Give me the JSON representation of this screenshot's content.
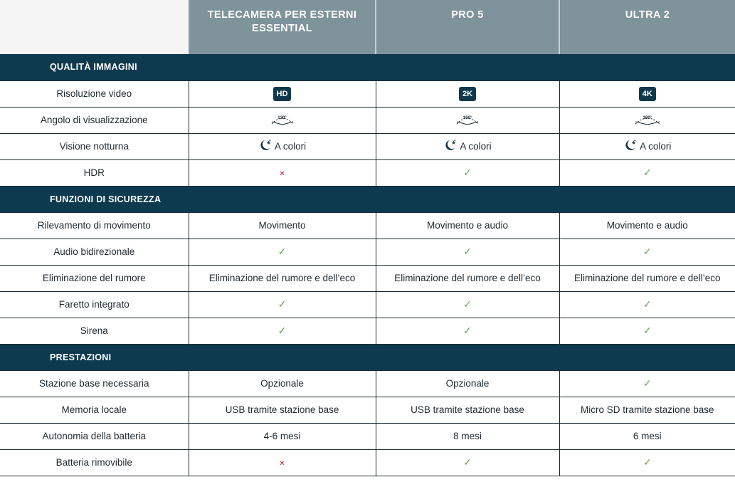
{
  "header": {
    "columns": [
      "TELECAMERA PER ESTERNI ESSENTIAL",
      "PRO 5",
      "ULTRA 2"
    ]
  },
  "sections": [
    {
      "title": "QUALITÀ IMMAGINI",
      "rows": [
        {
          "label": "Risoluzione video",
          "cells": [
            {
              "type": "badge",
              "text": "HD"
            },
            {
              "type": "badge",
              "text": "2K"
            },
            {
              "type": "badge",
              "text": "4K"
            }
          ]
        },
        {
          "label": "Angolo di visualizzazione",
          "cells": [
            {
              "type": "angle",
              "text": "130°",
              "icon": "viewing-angle-icon"
            },
            {
              "type": "angle",
              "text": "160°",
              "icon": "viewing-angle-icon"
            },
            {
              "type": "angle",
              "text": "180°",
              "icon": "viewing-angle-icon"
            }
          ]
        },
        {
          "label": "Visione notturna",
          "cells": [
            {
              "type": "night",
              "text": "A colori",
              "icon": "moon-stars-icon"
            },
            {
              "type": "night",
              "text": "A colori",
              "icon": "moon-stars-icon"
            },
            {
              "type": "night",
              "text": "A colori",
              "icon": "moon-stars-icon"
            }
          ]
        },
        {
          "label": "HDR",
          "cells": [
            {
              "type": "no",
              "text": "×"
            },
            {
              "type": "yes",
              "text": "✓"
            },
            {
              "type": "yes",
              "text": "✓"
            }
          ]
        }
      ]
    },
    {
      "title": "FUNZIONI DI SICUREZZA",
      "rows": [
        {
          "label": "Rilevamento di movimento",
          "cells": [
            {
              "type": "text",
              "text": "Movimento"
            },
            {
              "type": "text",
              "text": "Movimento e audio"
            },
            {
              "type": "text",
              "text": "Movimento e audio"
            }
          ]
        },
        {
          "label": "Audio bidirezionale",
          "cells": [
            {
              "type": "yes",
              "text": "✓"
            },
            {
              "type": "yes",
              "text": "✓"
            },
            {
              "type": "yes",
              "text": "✓"
            }
          ]
        },
        {
          "label": "Eliminazione del rumore",
          "cells": [
            {
              "type": "text",
              "text": "Eliminazione del rumore e dell’eco"
            },
            {
              "type": "text",
              "text": "Eliminazione del rumore e dell’eco"
            },
            {
              "type": "text",
              "text": "Eliminazione del rumore e dell’eco"
            }
          ]
        },
        {
          "label": "Faretto integrato",
          "cells": [
            {
              "type": "yes",
              "text": "✓"
            },
            {
              "type": "yes",
              "text": "✓"
            },
            {
              "type": "yes",
              "text": "✓"
            }
          ]
        },
        {
          "label": "Sirena",
          "cells": [
            {
              "type": "yes",
              "text": "✓"
            },
            {
              "type": "yes",
              "text": "✓"
            },
            {
              "type": "yes",
              "text": "✓"
            }
          ]
        }
      ]
    },
    {
      "title": "PRESTAZIONI",
      "rows": [
        {
          "label": "Stazione base necessaria",
          "cells": [
            {
              "type": "text",
              "text": "Opzionale"
            },
            {
              "type": "text",
              "text": "Opzionale"
            },
            {
              "type": "yes",
              "text": "✓"
            }
          ]
        },
        {
          "label": "Memoria locale",
          "cells": [
            {
              "type": "text",
              "text": "USB tramite stazione base"
            },
            {
              "type": "text",
              "text": "USB tramite stazione base"
            },
            {
              "type": "text",
              "text": "Micro SD tramite stazione base"
            }
          ]
        },
        {
          "label": "Autonomia della batteria",
          "cells": [
            {
              "type": "text",
              "text": "4-6 mesi"
            },
            {
              "type": "text",
              "text": "8 mesi"
            },
            {
              "type": "text",
              "text": "6 mesi"
            }
          ]
        },
        {
          "label": "Batteria rimovibile",
          "cells": [
            {
              "type": "no",
              "text": "×"
            },
            {
              "type": "yes",
              "text": "✓"
            },
            {
              "type": "yes",
              "text": "✓"
            }
          ]
        }
      ]
    }
  ],
  "colors": {
    "header_bg": "#7f939b",
    "section_bg": "#0e3a4f",
    "badge_bg": "#103a4c",
    "check": "#5fae3f",
    "cross": "#e0353b"
  }
}
